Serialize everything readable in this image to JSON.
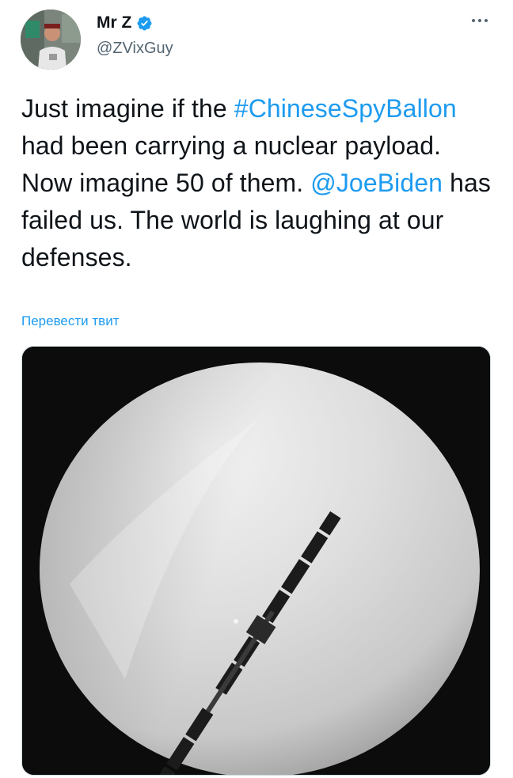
{
  "author": {
    "display_name": "Mr Z",
    "handle": "@ZVixGuy",
    "verified": true,
    "avatar_icon": "user-avatar"
  },
  "tweet": {
    "text_segments": [
      {
        "type": "text",
        "value": "Just imagine if the "
      },
      {
        "type": "link",
        "value": "#ChineseSpyBallon"
      },
      {
        "type": "text",
        "value": " had been carrying a nuclear payload. Now imagine 50 of them. "
      },
      {
        "type": "link",
        "value": "@JoeBiden"
      },
      {
        "type": "text",
        "value": " has failed us. The world is laughing at our defenses."
      }
    ],
    "translate_label": "Перевести твит"
  },
  "icons": {
    "verified": "verified-badge-icon",
    "more": "more-options-icon"
  },
  "colors": {
    "link": "#1d9bf0",
    "verified": "#1d9bf0",
    "text": "#0f1419",
    "secondary": "#536471"
  }
}
